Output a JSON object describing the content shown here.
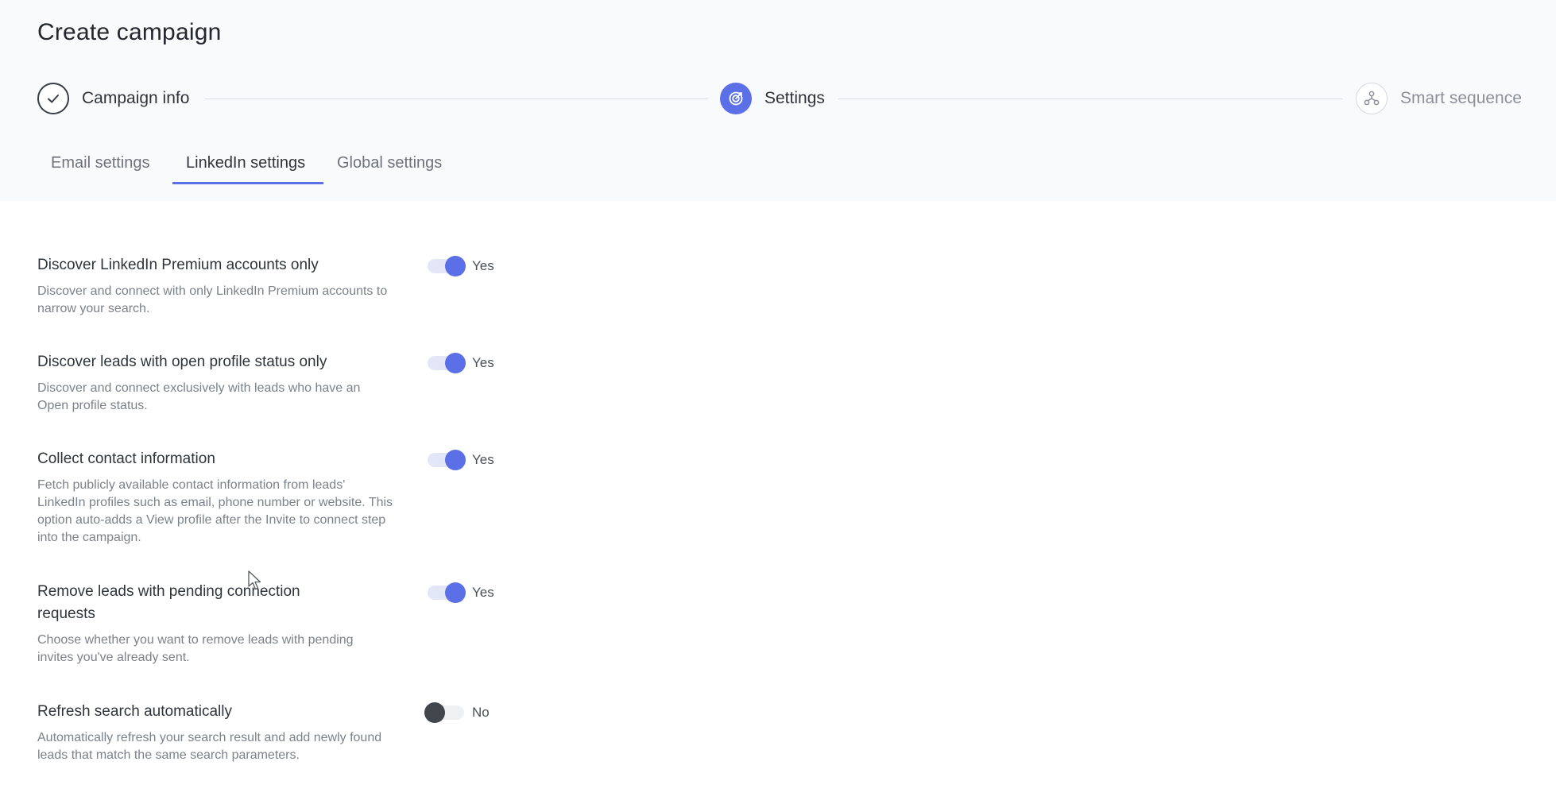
{
  "page": {
    "title": "Create campaign"
  },
  "stepper": {
    "steps": [
      {
        "label": "Campaign info",
        "state": "completed",
        "icon": "check-icon"
      },
      {
        "label": "Settings",
        "state": "active",
        "icon": "target-icon"
      },
      {
        "label": "Smart sequence",
        "state": "pending",
        "icon": "sequence-icon"
      }
    ]
  },
  "tabs": [
    {
      "label": "Email settings",
      "active": false
    },
    {
      "label": "LinkedIn settings",
      "active": true
    },
    {
      "label": "Global settings",
      "active": false
    }
  ],
  "settings": [
    {
      "title": "Discover LinkedIn Premium accounts only",
      "description": "Discover and connect with only LinkedIn Premium accounts to narrow your search.",
      "enabled": true,
      "state_label": "Yes"
    },
    {
      "title": "Discover leads with open profile status only",
      "description": "Discover and connect exclusively with leads who have an Open profile status.",
      "enabled": true,
      "state_label": "Yes"
    },
    {
      "title": "Collect contact information",
      "description": "Fetch publicly available contact information from leads' LinkedIn profiles such as email, phone number or website. This option auto-adds a View profile after the Invite to connect step into the campaign.",
      "enabled": true,
      "state_label": "Yes"
    },
    {
      "title": "Remove leads with pending connection requests",
      "description": "Choose whether you want to remove leads with pending invites you've already sent.",
      "enabled": true,
      "state_label": "Yes"
    },
    {
      "title": "Refresh search automatically",
      "description": "Automatically refresh your search result and add newly found leads that match the same search parameters.",
      "enabled": false,
      "state_label": "No"
    }
  ],
  "colors": {
    "accent": "#5b70e6",
    "toggle_track_on": "#e3e6f7",
    "toggle_knob_off": "#41454c",
    "header_bg": "#f9fafb"
  }
}
